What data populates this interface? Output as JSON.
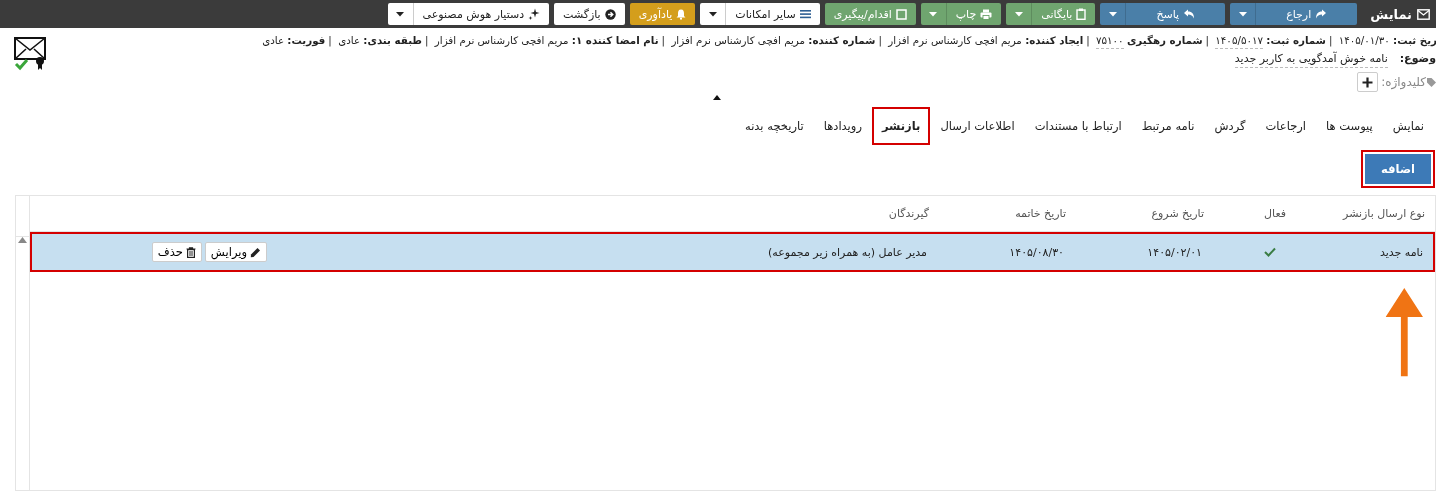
{
  "toolbar": {
    "title": "نمایش",
    "buttons": [
      {
        "kind": "forward",
        "label": "ارجاع",
        "split": true
      },
      {
        "kind": "reply",
        "label": "پاسخ",
        "split": true
      },
      {
        "kind": "archive",
        "label": "بایگانی",
        "split": true
      },
      {
        "kind": "print",
        "label": "چاپ",
        "split": true
      },
      {
        "kind": "action",
        "label": "اقدام/پیگیری",
        "split": false
      },
      {
        "kind": "more",
        "label": "سایر امکانات",
        "split": true
      },
      {
        "kind": "reminder",
        "label": "یادآوری",
        "split": false
      },
      {
        "kind": "back",
        "label": "بازگشت",
        "split": false
      },
      {
        "kind": "ai",
        "label": "دستیار هوش مصنوعی",
        "split": true
      }
    ]
  },
  "meta": [
    {
      "label": "ریخ ثبت:",
      "value": "۱۴۰۵/۰۱/۳۰",
      "underlined": false,
      "separator": "|"
    },
    {
      "label": "شماره ثبت:",
      "value": "۱۴۰۵/۵۰۱۷",
      "underlined": true,
      "separator": "|"
    },
    {
      "label": "شماره رهگیری",
      "value": "۷۵۱۰۰",
      "underlined": true,
      "separator": "|"
    },
    {
      "label": "ایجاد کننده:",
      "value": "مریم افچی کارشناس نرم افزار",
      "underlined": false,
      "separator": "|"
    },
    {
      "label": "شماره کننده:",
      "value": "مریم افچی کارشناس نرم افزار",
      "underlined": false,
      "separator": "|"
    },
    {
      "label": "نام امضا کننده ۱:",
      "value": "مریم افچی کارشناس نرم افزار",
      "underlined": false,
      "separator": "|"
    },
    {
      "label": "طبقه بندی:",
      "value": "عادی",
      "underlined": false,
      "separator": "|"
    },
    {
      "label": "فوریت:",
      "value": "عادی",
      "underlined": false
    }
  ],
  "subject": {
    "label": "وضوع:",
    "value": "نامه خوش آمدگویی به کاربر جدید"
  },
  "keywords": {
    "label": "کلیدواژه:"
  },
  "tabs": [
    {
      "label": "نمایش",
      "selected": false
    },
    {
      "label": "پیوست ها",
      "selected": false
    },
    {
      "label": "ارجاعات",
      "selected": false
    },
    {
      "label": "گردش",
      "selected": false
    },
    {
      "label": "نامه مرتبط",
      "selected": false
    },
    {
      "label": "ارتباط با مستندات",
      "selected": false
    },
    {
      "label": "اطلاعات ارسال",
      "selected": false
    },
    {
      "label": "بازنشر",
      "selected": true
    },
    {
      "label": "رویدادها",
      "selected": false
    },
    {
      "label": "تاریخچه بدنه",
      "selected": false
    }
  ],
  "add_button": {
    "label": "اضافه",
    "highlighted": true
  },
  "table": {
    "columns": [
      "نوع ارسال بازنشر",
      "فعال",
      "تاریخ شروع",
      "تاریخ خاتمه",
      "گیرندگان"
    ],
    "rows": [
      {
        "type": "نامه جدید",
        "active": true,
        "start": "۱۴۰۵/۰۲/۰۱",
        "end": "۱۴۰۵/۰۸/۳۰",
        "recipients": "مدیر عامل (به همراه زیر مجموعه)",
        "selected": true,
        "highlighted": true,
        "actions": [
          {
            "kind": "edit",
            "label": "ویرایش"
          },
          {
            "kind": "delete",
            "label": "حذف"
          }
        ]
      }
    ]
  }
}
